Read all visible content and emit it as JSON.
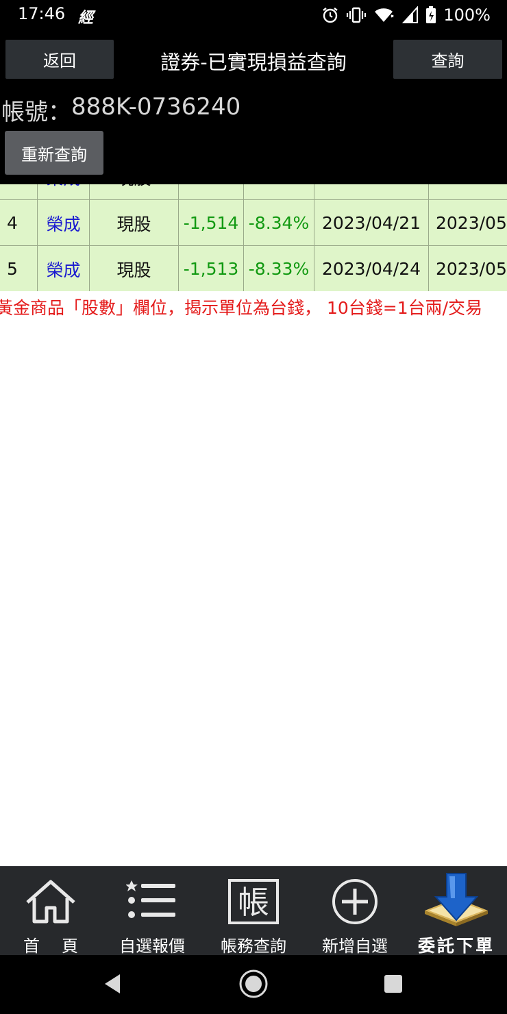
{
  "status_bar": {
    "time": "17:46",
    "app_glyph": "經",
    "battery": "100%"
  },
  "header": {
    "back_label": "返回",
    "title": "證券-已實現損益查詢",
    "query_label": "查詢",
    "account_label": "帳號：",
    "account_value": "888K-0736240",
    "requery_label": "重新查詢"
  },
  "table": {
    "partial_row": {
      "name": "榮成",
      "type": "現股"
    },
    "rows": [
      {
        "idx": "4",
        "name": "榮成",
        "type": "現股",
        "pl": "-1,514",
        "pct": "-8.34%",
        "buy_date": "2023/04/21",
        "sell_date": "2023/05"
      },
      {
        "idx": "5",
        "name": "榮成",
        "type": "現股",
        "pl": "-1,513",
        "pct": "-8.33%",
        "buy_date": "2023/04/24",
        "sell_date": "2023/05"
      }
    ]
  },
  "notice": "黃金商品「股數」欄位，揭示單位為台錢， 10台錢=1台兩/交易",
  "tabbar": {
    "items": [
      {
        "label": "首頁",
        "icon": "home-icon"
      },
      {
        "label": "自選報價",
        "icon": "list-icon"
      },
      {
        "label": "帳務查詢",
        "icon": "account-icon"
      },
      {
        "label": "新增自選",
        "icon": "plus-circle-icon"
      },
      {
        "label": "委託下單",
        "icon": "order-arrow-icon"
      }
    ]
  },
  "colors": {
    "header_bg": "#000000",
    "button_bg": "#2d3135",
    "table_bg": "#dff5c9",
    "stock_name": "#1a1ad0",
    "loss_green": "#119911",
    "notice_red": "#e41b1b",
    "tabbar_bg": "#27292c"
  }
}
